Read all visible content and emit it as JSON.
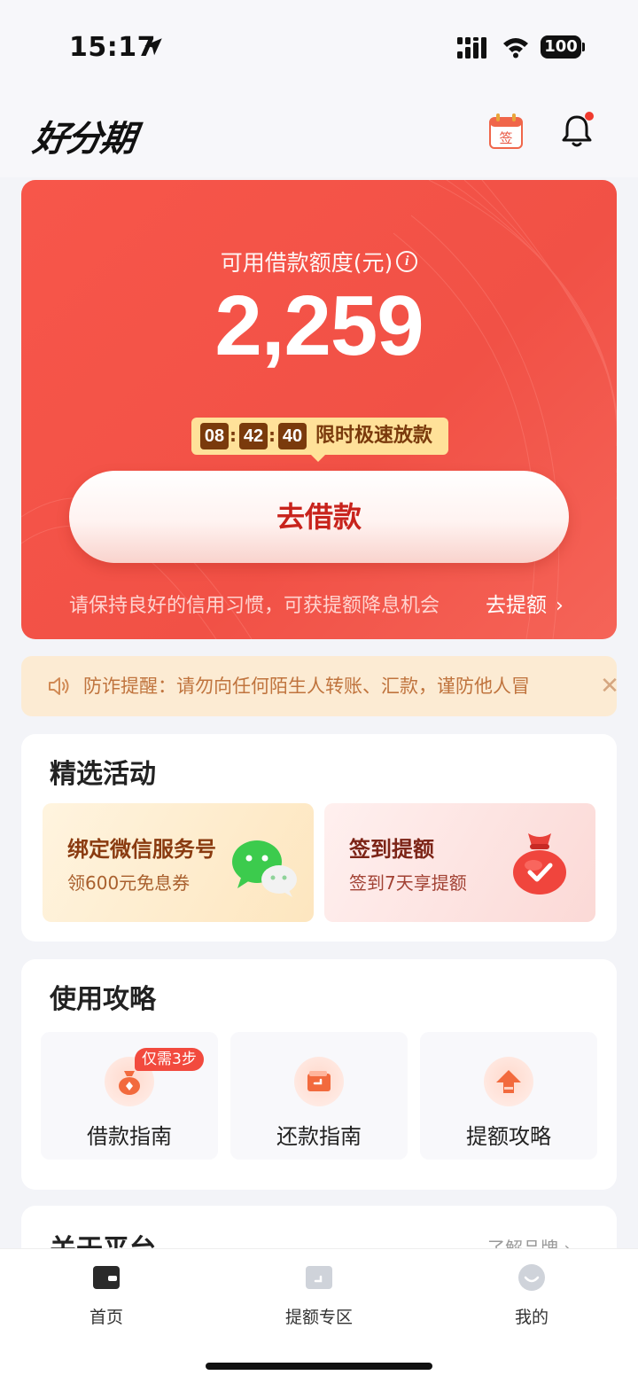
{
  "status_bar": {
    "time": "15:17",
    "battery": "100"
  },
  "header": {
    "logo": "好分期",
    "checkin_badge": "签"
  },
  "credit": {
    "label": "可用借款额度(元)",
    "info_glyph": "i",
    "amount": "2,259",
    "countdown": {
      "hours": "08",
      "minutes": "42",
      "seconds": "40",
      "separator": ":",
      "text": "限时极速放款"
    },
    "borrow_button": "去借款",
    "tip": "请保持良好的信用习惯，可获提额降息机会",
    "raise_link": "去提额",
    "chevron": "›"
  },
  "notice": {
    "text": "防诈提醒：请勿向任何陌生人转账、汇款，谨防他人冒",
    "close": "✕"
  },
  "activities": {
    "title": "精选活动",
    "items": [
      {
        "title": "绑定微信服务号",
        "subtitle": "领600元免息券",
        "icon": "wechat-icon"
      },
      {
        "title": "签到提额",
        "subtitle": "签到7天享提额",
        "icon": "money-bag-icon"
      }
    ]
  },
  "guides": {
    "title": "使用攻略",
    "items": [
      {
        "label": "借款指南",
        "badge": "仅需3步",
        "icon": "money-bag-icon"
      },
      {
        "label": "还款指南",
        "icon": "wallet-icon"
      },
      {
        "label": "提额攻略",
        "icon": "arrow-up-icon"
      }
    ]
  },
  "about": {
    "title": "关于平台",
    "link": "了解品牌 ›"
  },
  "tab_bar": {
    "items": [
      {
        "label": "首页",
        "icon": "wallet-icon",
        "active": true
      },
      {
        "label": "提额专区",
        "icon": "card-icon",
        "active": false
      },
      {
        "label": "我的",
        "icon": "profile-icon",
        "active": false
      }
    ]
  },
  "colors": {
    "accent": "#f15146",
    "countdown_bg": "#ffe199",
    "notice_bg": "#fcebd3"
  }
}
